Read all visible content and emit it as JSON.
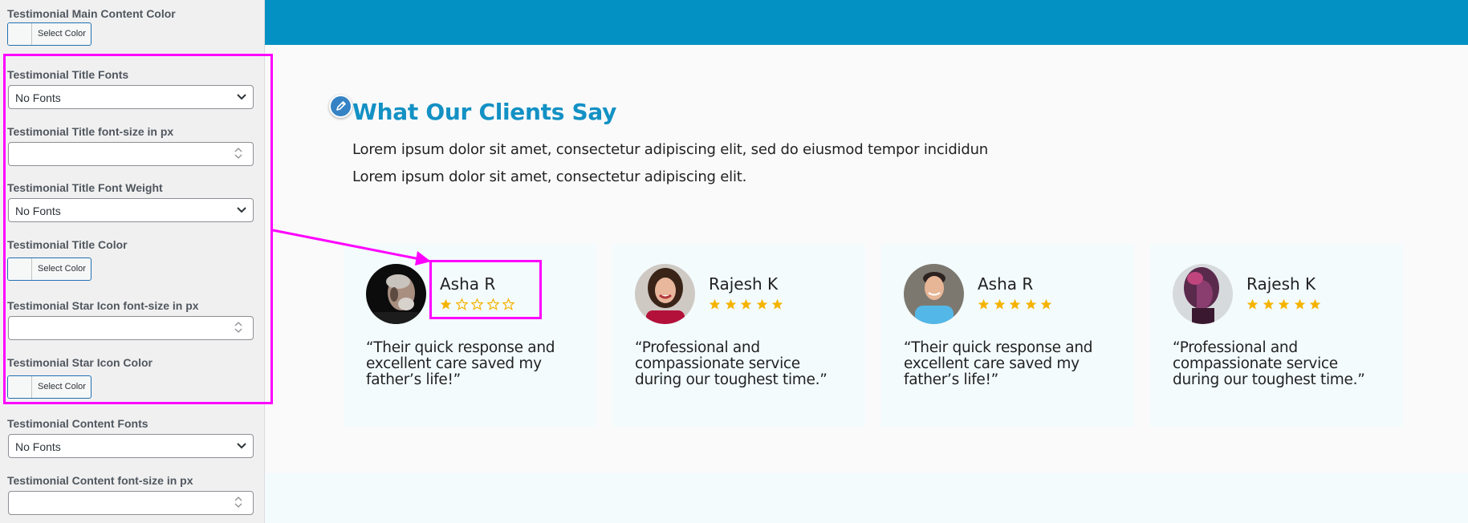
{
  "sidebar": {
    "main_content_color": {
      "label": "Testimonial Main Content Color",
      "button": "Select Color"
    },
    "title_fonts": {
      "label": "Testimonial Title Fonts",
      "value": "No Fonts"
    },
    "title_font_size": {
      "label": "Testimonial Title font-size in px",
      "value": ""
    },
    "title_font_weight": {
      "label": "Testimonial Title Font Weight",
      "value": "No Fonts"
    },
    "title_color": {
      "label": "Testimonial Title Color",
      "button": "Select Color"
    },
    "star_icon_font_size": {
      "label": "Testimonial Star Icon font-size in px",
      "value": ""
    },
    "star_icon_color": {
      "label": "Testimonial Star Icon Color",
      "button": "Select Color"
    },
    "content_fonts": {
      "label": "Testimonial Content Fonts",
      "value": "No Fonts"
    },
    "content_font_size": {
      "label": "Testimonial Content font-size in px",
      "value": ""
    }
  },
  "preview": {
    "title": "What Our Clients Say",
    "description_lines": [
      "Lorem ipsum dolor sit amet, consectetur adipiscing elit, sed do eiusmod tempor incididun",
      "Lorem ipsum dolor sit amet, consectetur adipiscing elit."
    ],
    "testimonials": [
      {
        "name": "Asha R",
        "rating": 1,
        "quote": "“Their quick response and excellent care saved my father’s life!”",
        "avatar": "elderly-man-portrait"
      },
      {
        "name": "Rajesh K",
        "rating": 5,
        "quote": "“Professional and compassionate service during our toughest time.”",
        "avatar": "smiling-woman-portrait"
      },
      {
        "name": "Asha R",
        "rating": 5,
        "quote": "“Their quick response and excellent care saved my father’s life!”",
        "avatar": "young-man-portrait"
      },
      {
        "name": "Rajesh K",
        "rating": 5,
        "quote": "“Professional and compassionate service during our toughest time.”",
        "avatar": "woman-profile-portrait"
      }
    ]
  },
  "colors": {
    "header_bar": "#0391c3",
    "title": "#1391c4",
    "star": "#f5b301",
    "highlight": "#ff00ff",
    "card_bg": "#f3fbfd"
  },
  "icons": {
    "edit": "pencil-icon",
    "select": "chevron-down-icon",
    "spinner": "number-spinner-icon",
    "star": "star-icon"
  }
}
